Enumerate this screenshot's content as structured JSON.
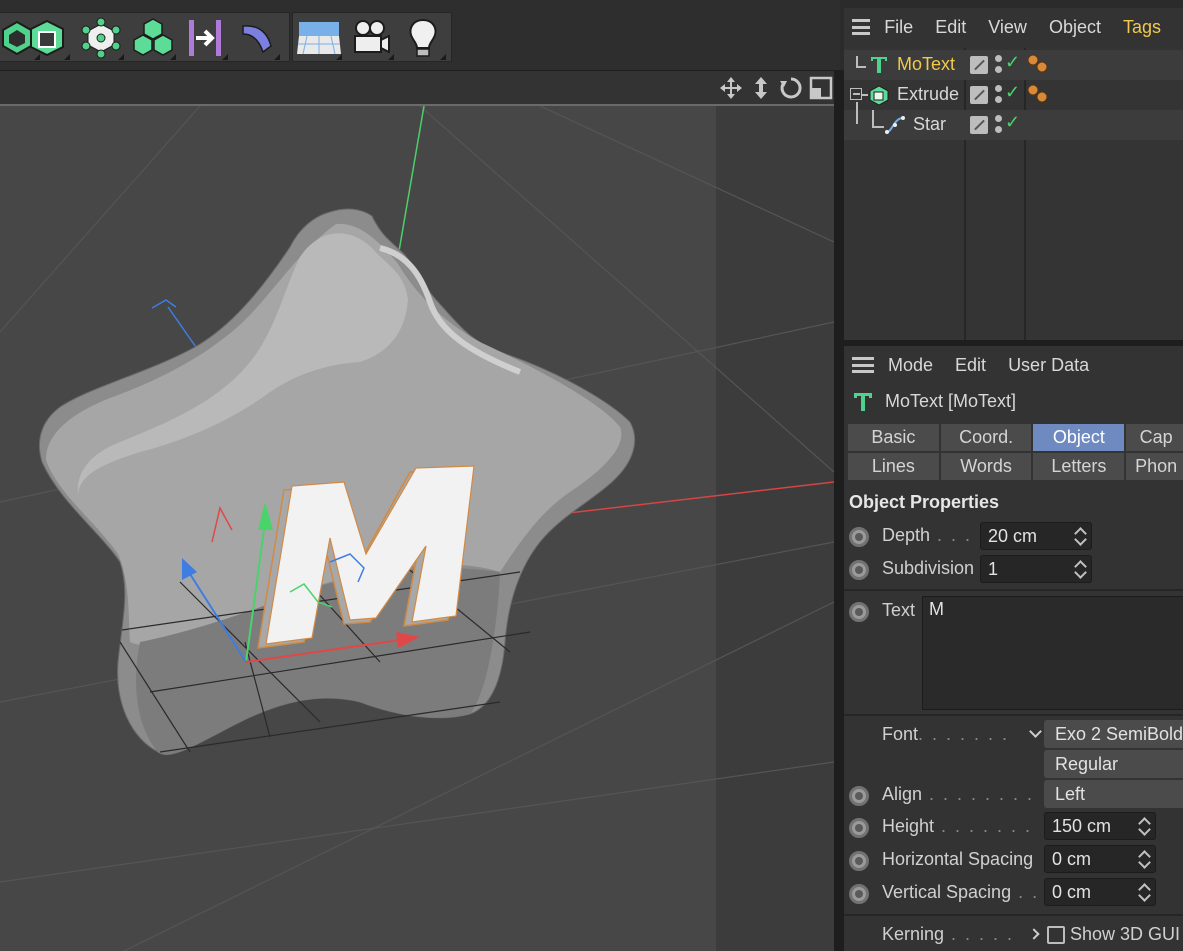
{
  "colors": {
    "accent": "#f2c94c",
    "active_tab": "#6e8ac0",
    "check_green": "#49d36b"
  },
  "toolbar": {
    "buttons": [
      {
        "name": "polygon-object-icon"
      },
      {
        "name": "cube-object-icon"
      },
      {
        "name": "generator-object-icon"
      },
      {
        "name": "cloner-object-icon"
      },
      {
        "name": "deformer-object-icon"
      },
      {
        "name": "bend-deformer-icon"
      },
      {
        "name": "floor-environment-icon"
      },
      {
        "name": "camera-icon"
      },
      {
        "name": "light-icon"
      }
    ]
  },
  "viewport": {
    "nav_icons": [
      "move-view-icon",
      "zoom-view-icon",
      "rotate-view-icon",
      "toggle-view-icon"
    ],
    "text_object_letter": "M"
  },
  "object_manager": {
    "menu": [
      "File",
      "Edit",
      "View",
      "Object",
      "Tags"
    ],
    "objects": [
      {
        "name": "MoText",
        "icon": "motext-icon",
        "active": true
      },
      {
        "name": "Extrude",
        "icon": "extrude-icon",
        "active": false
      },
      {
        "name": "Star",
        "icon": "spline-star-icon",
        "active": false
      }
    ]
  },
  "attribute_manager": {
    "menu": [
      "Mode",
      "Edit",
      "User Data"
    ],
    "title": "MoText [MoText]",
    "tabs_row1": [
      "Basic",
      "Coord.",
      "Object",
      "Cap"
    ],
    "tabs_row2": [
      "Lines",
      "Words",
      "Letters",
      "Phon"
    ],
    "active_tab": "Object",
    "section_title": "Object Properties",
    "fields": {
      "depth": {
        "label": "Depth",
        "value": "20 cm"
      },
      "subdivision": {
        "label": "Subdivision",
        "value": "1"
      },
      "text": {
        "label": "Text",
        "value": "M"
      },
      "font": {
        "label": "Font",
        "family": "Exo 2 SemiBold",
        "style": "Regular"
      },
      "align": {
        "label": "Align",
        "value": "Left"
      },
      "height": {
        "label": "Height",
        "value": "150 cm"
      },
      "horizontal_spacing": {
        "label": "Horizontal Spacing",
        "value": "0 cm"
      },
      "vertical_spacing": {
        "label": "Vertical Spacing",
        "value": "0 cm"
      },
      "kerning": {
        "label": "Kerning"
      },
      "show_3d_gui": {
        "label": "Show 3D GUI",
        "checked": false
      }
    }
  }
}
